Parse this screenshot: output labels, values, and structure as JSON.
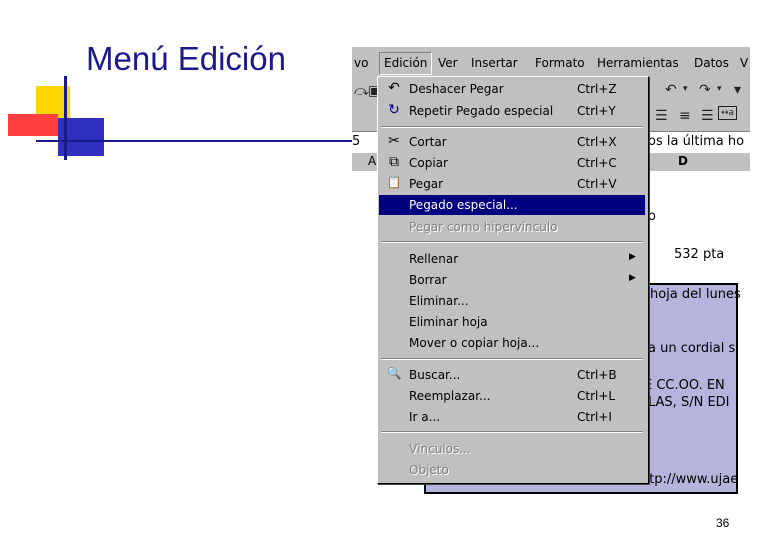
{
  "slide": {
    "title": "Menú Edición",
    "page_number": "36"
  },
  "excel": {
    "menubar": [
      "vo",
      "Edición",
      "Ver",
      "Insertar",
      "Formato",
      "Herramientas",
      "Datos",
      "V"
    ],
    "formula_row": {
      "cell_fragment": "5",
      "text_fragment": "os la última ho"
    },
    "column_headers": {
      "a": "A",
      "d": "D"
    },
    "cells": {
      "c1": "o",
      "c2": "532 pta",
      "c3": "hoja del lunes",
      "c4": "a un cordial s",
      "c5": "E CC.OO. EN",
      "c6": "LAS, S/N EDI",
      "c7": "ttp://www.ujae"
    },
    "toolbar_icons": [
      "cut-icon",
      "undo-icon",
      "redo-icon",
      "align-left-icon",
      "align-center-icon",
      "align-right-icon",
      "merge-center-icon"
    ]
  },
  "menu": {
    "items": [
      {
        "label": "Deshacer Pegar",
        "shortcut": "Ctrl+Z",
        "icon": "↶"
      },
      {
        "label": "Repetir Pegado especial",
        "shortcut": "Ctrl+Y",
        "icon": "↻"
      },
      {
        "label": "Cortar",
        "shortcut": "Ctrl+X",
        "icon": "✂"
      },
      {
        "label": "Copiar",
        "shortcut": "Ctrl+C",
        "icon": "⧉"
      },
      {
        "label": "Pegar",
        "shortcut": "Ctrl+V",
        "icon": "📋"
      },
      {
        "label": "Pegado especial...",
        "shortcut": ""
      },
      {
        "label": "Pegar como hipervínculo",
        "shortcut": ""
      },
      {
        "label": "Rellenar",
        "shortcut": ""
      },
      {
        "label": "Borrar",
        "shortcut": ""
      },
      {
        "label": "Eliminar...",
        "shortcut": ""
      },
      {
        "label": "Eliminar hoja",
        "shortcut": ""
      },
      {
        "label": "Mover o copiar hoja...",
        "shortcut": ""
      },
      {
        "label": "Buscar...",
        "shortcut": "Ctrl+B",
        "icon": "🔍"
      },
      {
        "label": "Reemplazar...",
        "shortcut": "Ctrl+L"
      },
      {
        "label": "Ir a...",
        "shortcut": "Ctrl+I"
      },
      {
        "label": "Vínculos...",
        "shortcut": ""
      },
      {
        "label": "Objeto",
        "shortcut": ""
      }
    ]
  },
  "colors": {
    "title": "#1a1a8c",
    "highlight": "#000080",
    "menu_bg": "#c0c0c0",
    "selection": "#b4b4dc"
  }
}
